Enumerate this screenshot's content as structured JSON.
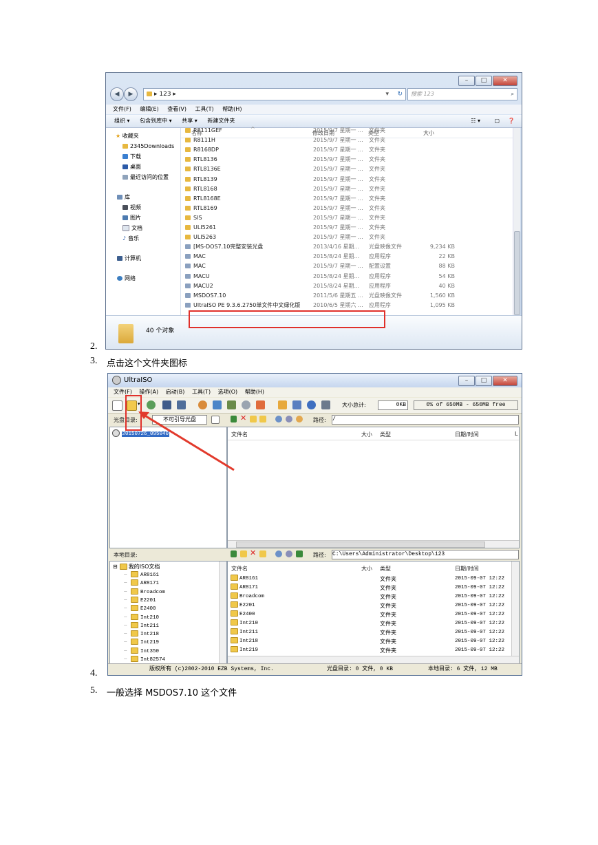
{
  "items": {
    "n2": "2.",
    "n3": "3.",
    "t3": "点击这个文件夹图标",
    "n4": "4.",
    "n5": "5.",
    "t5": "一般选择 MSDOS7.10 这个文件"
  },
  "explorer": {
    "address_path": "▸ 123 ▸",
    "search_placeholder": "搜索 123",
    "menu": [
      "文件(F)",
      "编辑(E)",
      "查看(V)",
      "工具(T)",
      "帮助(H)"
    ],
    "toolbar": [
      "组织 ▾",
      "包含到库中 ▾",
      "共享 ▾",
      "新建文件夹"
    ],
    "nav": {
      "favorites": "收藏夹",
      "fav_items": [
        "2345Downloads",
        "下载",
        "桌面",
        "最近访问的位置"
      ],
      "library": "库",
      "lib_items": [
        "视频",
        "图片",
        "文档",
        "音乐"
      ],
      "computer": "计算机",
      "network": "网络"
    },
    "columns": {
      "name": "名称",
      "date": "修改日期",
      "type": "类型",
      "size": "大小"
    },
    "files": [
      {
        "name": "R8111GEF",
        "date": "2015/9/7 星期一 ...",
        "type": "文件夹",
        "size": ""
      },
      {
        "name": "R8111H",
        "date": "2015/9/7 星期一 ...",
        "type": "文件夹",
        "size": ""
      },
      {
        "name": "R8168DP",
        "date": "2015/9/7 星期一 ...",
        "type": "文件夹",
        "size": ""
      },
      {
        "name": "RTL8136",
        "date": "2015/9/7 星期一 ...",
        "type": "文件夹",
        "size": ""
      },
      {
        "name": "RTL8136E",
        "date": "2015/9/7 星期一 ...",
        "type": "文件夹",
        "size": ""
      },
      {
        "name": "RTL8139",
        "date": "2015/9/7 星期一 ...",
        "type": "文件夹",
        "size": ""
      },
      {
        "name": "RTL8168",
        "date": "2015/9/7 星期一 ...",
        "type": "文件夹",
        "size": ""
      },
      {
        "name": "RTL8168E",
        "date": "2015/9/7 星期一 ...",
        "type": "文件夹",
        "size": ""
      },
      {
        "name": "RTL8169",
        "date": "2015/9/7 星期一 ...",
        "type": "文件夹",
        "size": ""
      },
      {
        "name": "SIS",
        "date": "2015/9/7 星期一 ...",
        "type": "文件夹",
        "size": ""
      },
      {
        "name": "ULI5261",
        "date": "2015/9/7 星期一 ...",
        "type": "文件夹",
        "size": ""
      },
      {
        "name": "ULI5263",
        "date": "2015/9/7 星期一 ...",
        "type": "文件夹",
        "size": ""
      },
      {
        "name": "[MS-DOS7.10完整安装光盘",
        "date": "2013/4/16 星期...",
        "type": "光盘映像文件",
        "size": "9,234 KB"
      },
      {
        "name": "MAC",
        "date": "2015/8/24 星期...",
        "type": "应用程序",
        "size": "22 KB"
      },
      {
        "name": "MAC",
        "date": "2015/9/7 星期一 ...",
        "type": "配置设置",
        "size": "88 KB"
      },
      {
        "name": "MACU",
        "date": "2015/8/24 星期...",
        "type": "应用程序",
        "size": "54 KB"
      },
      {
        "name": "MACU2",
        "date": "2015/8/24 星期...",
        "type": "应用程序",
        "size": "40 KB"
      },
      {
        "name": "MSDOS7.10",
        "date": "2011/5/6 星期五 ...",
        "type": "光盘映像文件",
        "size": "1,560 KB"
      },
      {
        "name": "UltraISO PE 9.3.6.2750单文件中文绿化版",
        "date": "2010/6/5 星期六 ...",
        "type": "应用程序",
        "size": "1,095 KB"
      }
    ],
    "status": "40 个对象"
  },
  "ultraiso": {
    "title": "UltraISO",
    "menu": [
      "文件(F)",
      "操作(A)",
      "启动(B)",
      "工具(T)",
      "选项(O)",
      "帮助(H)"
    ],
    "size_label": "大小总计:",
    "size_value": "0KB",
    "capacity": "0% of 650MB - 650MB free",
    "disc_dir_label": "光盘目录:",
    "boot_label": "不可引导光盘",
    "path_label": "路径:",
    "disc_path": "/",
    "disc_root": "20150726_095040",
    "upper_cols": {
      "name": "文件名",
      "size": "大小",
      "type": "类型",
      "date": "日期/时间",
      "extra": "L"
    },
    "local_dir_label": "本地目录:",
    "local_path": "C:\\Users\\Administrator\\Desktop\\123",
    "tree_root": "我的ISO文档",
    "tree": [
      "AR8161",
      "AR8171",
      "Broadcom",
      "E2201",
      "E2400",
      "Int210",
      "Int211",
      "Int218",
      "Int219",
      "Int350",
      "Int82574"
    ],
    "lower_cols": {
      "name": "文件名",
      "size": "大小",
      "type": "类型",
      "date": "日期/时间"
    },
    "local_files": [
      {
        "name": "AR8161",
        "type": "文件夹",
        "date": "2015-09-07 12:22"
      },
      {
        "name": "AR8171",
        "type": "文件夹",
        "date": "2015-09-07 12:22"
      },
      {
        "name": "Broadcom",
        "type": "文件夹",
        "date": "2015-09-07 12:22"
      },
      {
        "name": "E2201",
        "type": "文件夹",
        "date": "2015-09-07 12:22"
      },
      {
        "name": "E2400",
        "type": "文件夹",
        "date": "2015-09-07 12:22"
      },
      {
        "name": "Int210",
        "type": "文件夹",
        "date": "2015-09-07 12:22"
      },
      {
        "name": "Int211",
        "type": "文件夹",
        "date": "2015-09-07 12:22"
      },
      {
        "name": "Int218",
        "type": "文件夹",
        "date": "2015-09-07 12:22"
      },
      {
        "name": "Int219",
        "type": "文件夹",
        "date": "2015-09-07 12:22"
      }
    ],
    "status_copyright": "版权所有 (c)2002-2010 EZB Systems, Inc.",
    "status_disc": "光盘目录: 0 文件, 0 KB",
    "status_local": "本地目录: 6 文件, 12 MB"
  }
}
